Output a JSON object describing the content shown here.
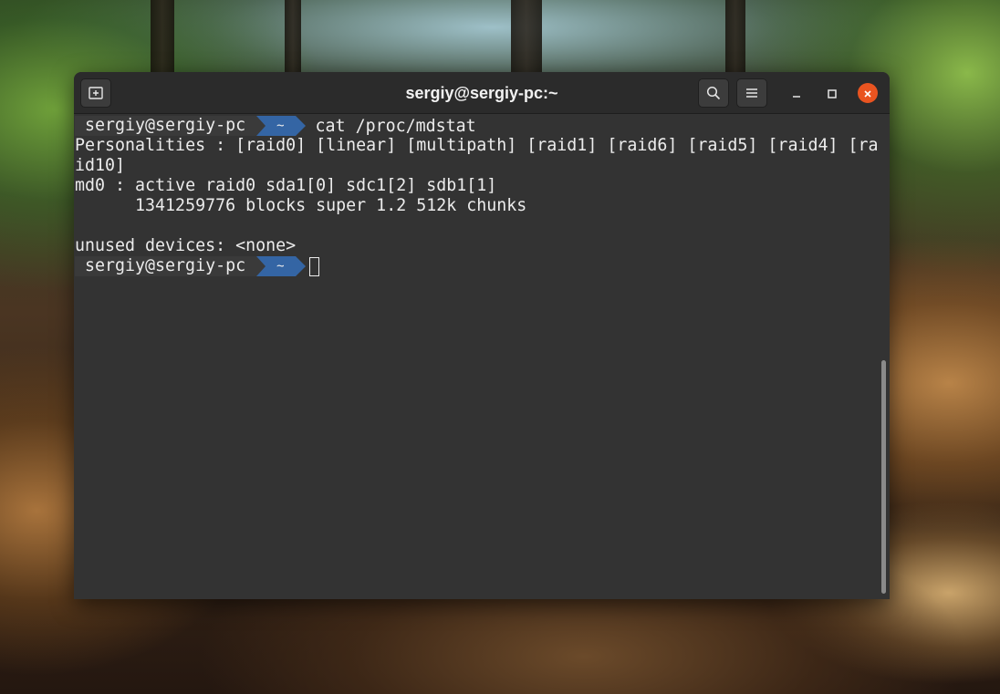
{
  "window": {
    "title": "sergiy@sergiy-pc:~",
    "new_tab_icon": "new-tab-icon",
    "search_icon": "search-icon",
    "menu_icon": "hamburger-menu-icon",
    "minimize_icon": "minimize-icon",
    "maximize_icon": "maximize-icon",
    "close_icon": "close-icon",
    "close_color": "#e95420"
  },
  "terminal": {
    "prompt_user": "sergiy@sergiy-pc",
    "prompt_dir": "~",
    "prompt_dir_color": "#3465a4",
    "command": "cat /proc/mdstat",
    "output": [
      "Personalities : [raid0] [linear] [multipath] [raid1] [raid6] [raid5] [raid4] [ra",
      "id10]",
      "md0 : active raid0 sda1[0] sdc1[2] sdb1[1]",
      "      1341259776 blocks super 1.2 512k chunks",
      "",
      "unused devices: <none>"
    ],
    "second_prompt_user": "sergiy@sergiy-pc",
    "second_prompt_dir": "~"
  }
}
